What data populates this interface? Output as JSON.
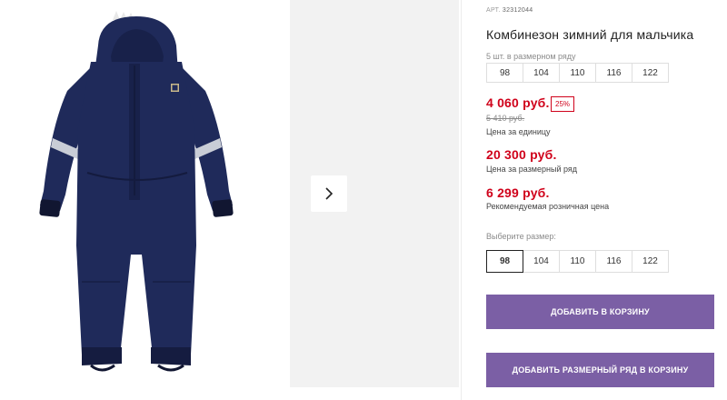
{
  "product": {
    "article_label": "АРТ.",
    "article_number": "32312044",
    "title": "Комбинезон зимний для мальчика"
  },
  "size_row": {
    "label": "5 шт. в размерном ряду",
    "sizes": [
      "98",
      "104",
      "110",
      "116",
      "122"
    ]
  },
  "pricing": {
    "unit_price": "4 060 руб.",
    "discount_badge": "25%",
    "old_price": "5 410 руб.",
    "unit_caption": "Цена за единицу",
    "row_price": "20 300 руб.",
    "row_caption": "Цена за размерный ряд",
    "retail_price": "6 299 руб.",
    "retail_caption": "Рекомендуемая розничная цена"
  },
  "size_selector": {
    "label": "Выберите размер:",
    "sizes": [
      "98",
      "104",
      "110",
      "116",
      "122"
    ],
    "selected": "98"
  },
  "actions": {
    "add_to_cart": "ДОБАВИТЬ В КОРЗИНУ",
    "add_row_to_cart": "ДОБАВИТЬ РАЗМЕРНЫЙ РЯД В КОРЗИНУ"
  },
  "colors": {
    "accent_button": "#7b5fa5",
    "price_red": "#d0021b",
    "garment_navy": "#1f2a5a"
  },
  "icons": {
    "next": "chevron-right-icon"
  }
}
